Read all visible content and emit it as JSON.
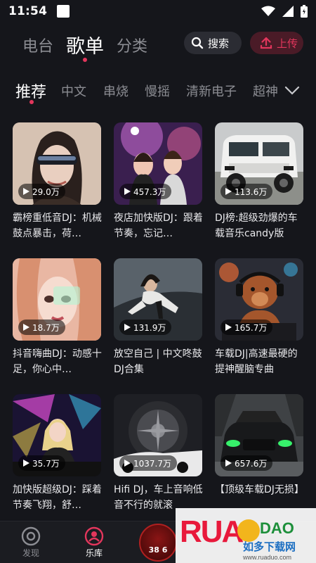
{
  "status_bar": {
    "time": "11:54"
  },
  "top_tabs": [
    {
      "label": "电台",
      "active": false
    },
    {
      "label": "歌单",
      "active": true
    },
    {
      "label": "分类",
      "active": false
    }
  ],
  "search": {
    "label": "搜索"
  },
  "upload": {
    "label": "上传"
  },
  "categories": [
    {
      "label": "推荐",
      "active": true
    },
    {
      "label": "中文"
    },
    {
      "label": "串烧"
    },
    {
      "label": "慢摇"
    },
    {
      "label": "清新电子"
    },
    {
      "label": "超神"
    }
  ],
  "playlists": [
    {
      "plays": "29.0万",
      "title": "霸榜重低音DJ：机械鼓点暴击，荷…"
    },
    {
      "plays": "457.3万",
      "title": "夜店加快版DJ：跟着节奏，忘记…"
    },
    {
      "plays": "113.6万",
      "title": "DJ榜:超级劲爆的车载音乐candy版"
    },
    {
      "plays": "18.7万",
      "title": "抖音嗨曲DJ：动感十足，你心中…"
    },
    {
      "plays": "131.9万",
      "title": "放空自己 | 中文咚鼓DJ合集"
    },
    {
      "plays": "165.7万",
      "title": "车载DJ|高速最硬的提神醒脑专曲"
    },
    {
      "plays": "35.7万",
      "title": "加快版超级DJ：踩着节奏飞翔，舒…"
    },
    {
      "plays": "1037.7万",
      "title": "Hifi DJ，车上音响低音不行的就滚"
    },
    {
      "plays": "657.6万",
      "title": "【顶级车载DJ无损】"
    }
  ],
  "bottom_nav": {
    "discover": "发现",
    "library": "乐库",
    "avatar_text": "38 6"
  },
  "watermark": {
    "logo": "RUANDAO",
    "line1": "如多下载网",
    "line2": "www.ruaduo.com"
  },
  "colors": {
    "accent": "#e3365c",
    "background": "#15161b"
  }
}
